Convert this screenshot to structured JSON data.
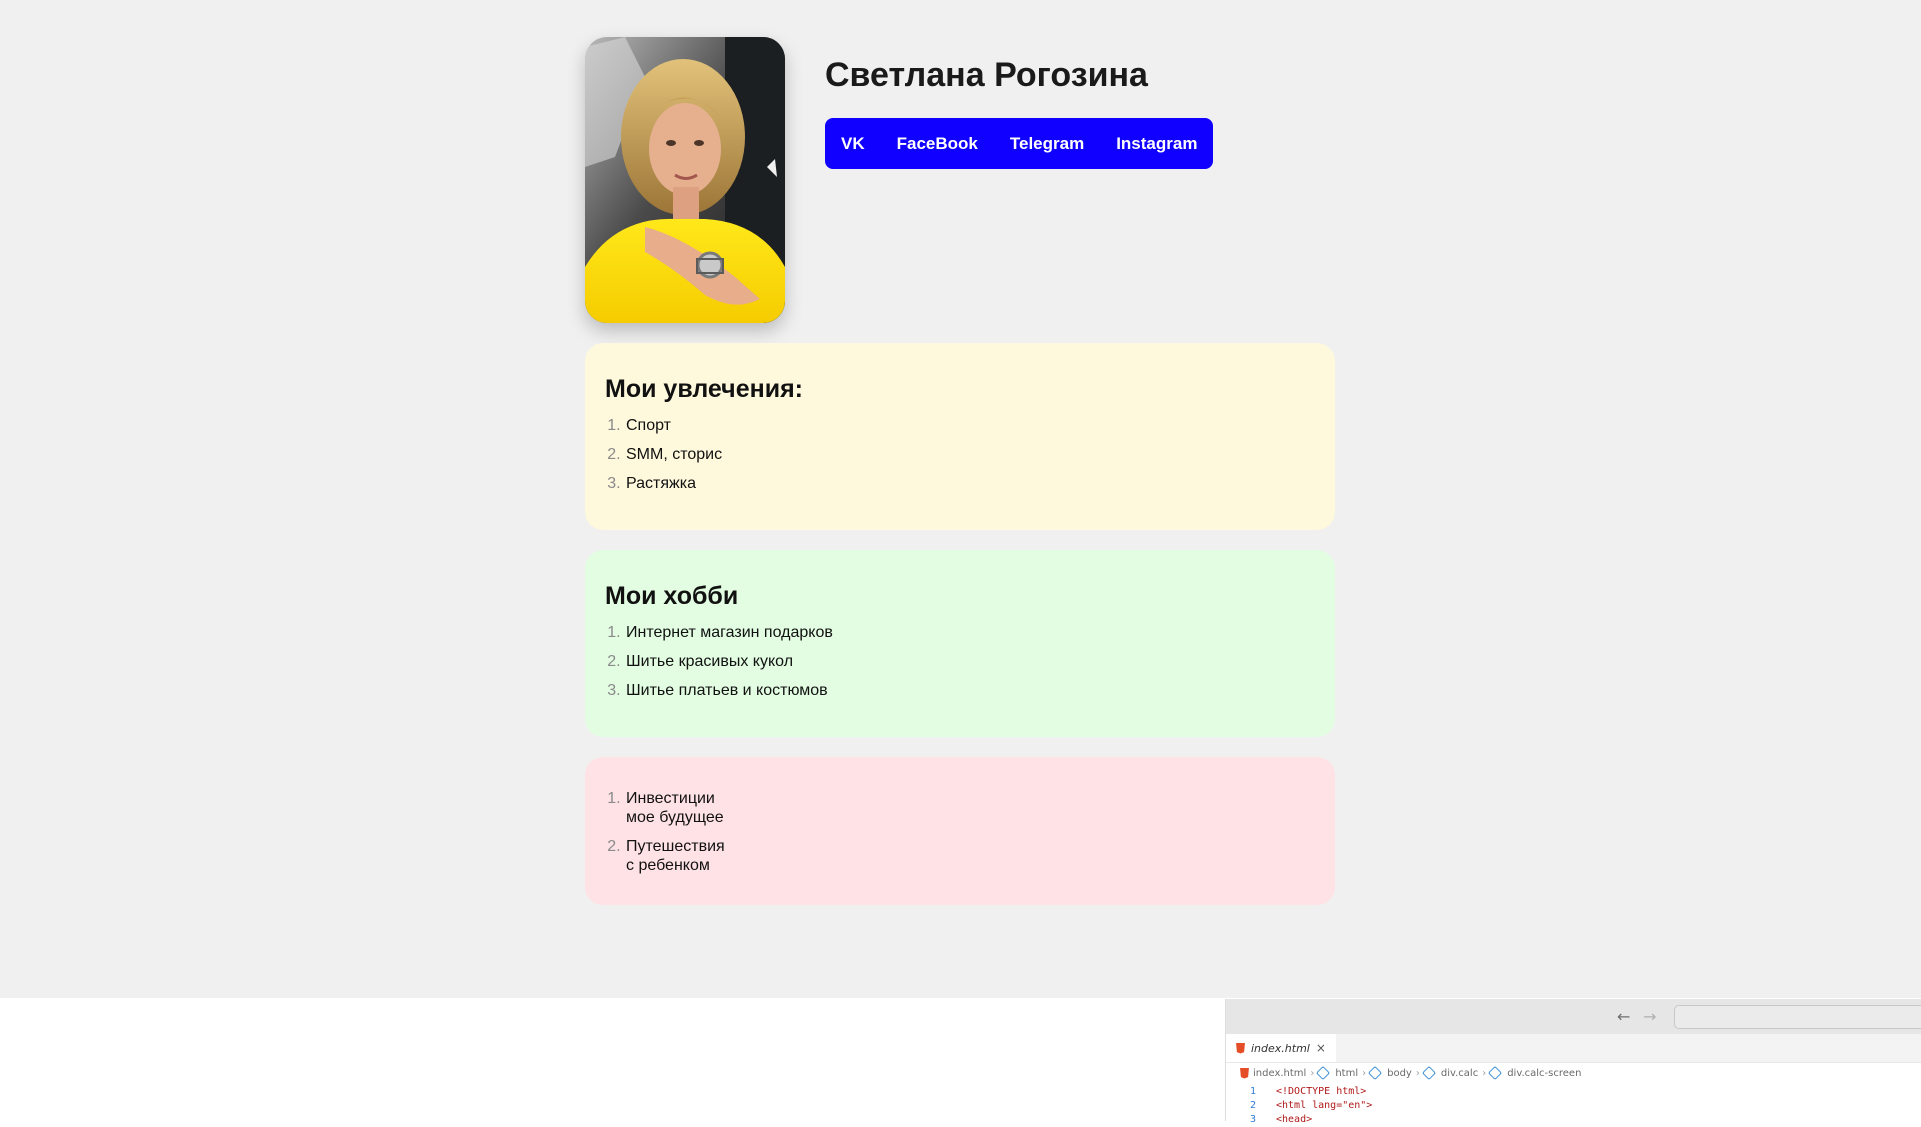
{
  "profile": {
    "name": "Светлана Рогозина",
    "photo_alt": "",
    "social_links": [
      {
        "label": "VK"
      },
      {
        "label": "FaceBook"
      },
      {
        "label": "Telegram"
      },
      {
        "label": "Instagram"
      }
    ]
  },
  "interests": {
    "title": "Мои увлечения:",
    "items": [
      "Спорт",
      "SMM, сторис",
      "Растяжка"
    ]
  },
  "hobbies": {
    "title": "Мои хобби",
    "items": [
      "Интернет магазин подарков",
      "Шитье красивых кукол",
      "Шитье платьев и костюмов"
    ]
  },
  "goals": {
    "items": [
      {
        "line1": "Инвестиции",
        "line2": "мое будущее"
      },
      {
        "line1": "Путешествия",
        "line2": "с ребенком"
      }
    ]
  },
  "editor": {
    "tab_label": "index.html",
    "tab_close": "×",
    "nav_back": "←",
    "nav_forward": "→",
    "breadcrumb": [
      "index.html",
      "html",
      "body",
      "div.calc",
      "div.calc-screen"
    ],
    "code_lines": [
      {
        "no": "1",
        "text": "<!DOCTYPE html>"
      },
      {
        "no": "2",
        "text": "<html lang=\"en\">"
      },
      {
        "no": "3",
        "text": "<head>"
      }
    ]
  },
  "colors": {
    "page_bg": "#f0f0f0",
    "social_bar": "#1000ff",
    "card_yellow": "#fef8dc",
    "card_green": "#e2fde2",
    "card_pink": "#ffe2e5"
  }
}
